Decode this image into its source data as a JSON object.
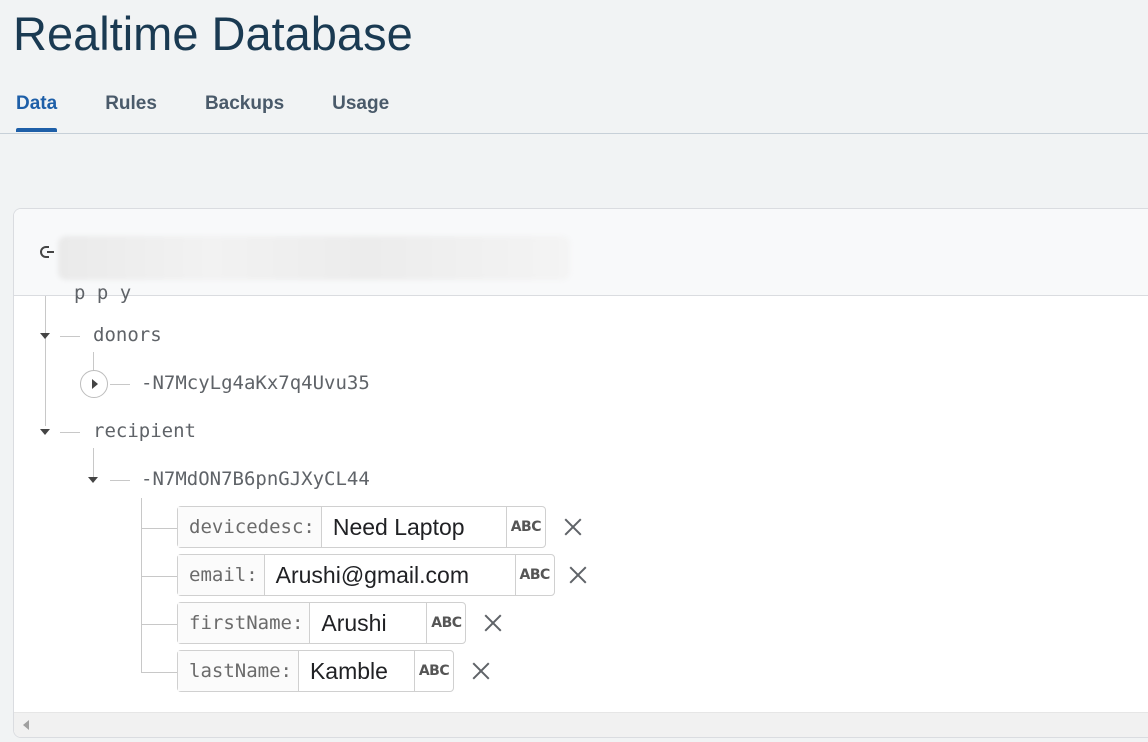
{
  "header": {
    "title": "Realtime Database"
  },
  "tabs": [
    {
      "label": "Data",
      "active": true
    },
    {
      "label": "Rules",
      "active": false
    },
    {
      "label": "Backups",
      "active": false
    },
    {
      "label": "Usage",
      "active": false
    }
  ],
  "tree": {
    "partial_top_text": "p       p  y",
    "donors": {
      "label": "donors",
      "children": [
        {
          "label": "-N7McyLg4aKx7q4Uvu35"
        }
      ]
    },
    "recipient": {
      "label": "recipient",
      "child_label": "-N7MdON7B6pnGJXyCL44",
      "fields": [
        {
          "key": "devicedesc:",
          "value": "Need Laptop",
          "type": "ABC"
        },
        {
          "key": "email:",
          "value": "Arushi@gmail.com",
          "type": "ABC"
        },
        {
          "key": "firstName:",
          "value": "Arushi",
          "type": "ABC"
        },
        {
          "key": "lastName:",
          "value": "Kamble",
          "type": "ABC"
        }
      ]
    }
  },
  "icons": {
    "link": "link-icon",
    "expand": "chevron-right-icon",
    "collapse": "caret-down-icon",
    "delete": "close-icon"
  },
  "colors": {
    "accent": "#1e5fa8",
    "title": "#1a3a52"
  }
}
